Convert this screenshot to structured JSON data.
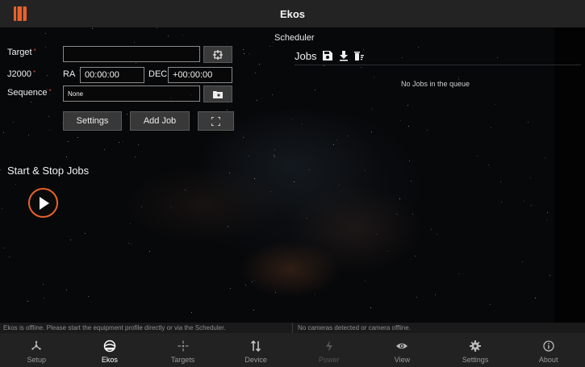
{
  "header": {
    "title": "Ekos",
    "app_icon": "notebook-icon"
  },
  "form": {
    "target_label": "Target",
    "target_value": "",
    "j2000_label": "J2000",
    "ra_label": "RA",
    "ra_value": "00:00:00",
    "dec_label": "DEC",
    "dec_value": "+00:00:00",
    "sequence_label": "Sequence",
    "sequence_value": "None",
    "required_marker": "*",
    "buttons": {
      "settings": "Settings",
      "add_job": "Add Job"
    }
  },
  "start_stop": {
    "title": "Start & Stop Jobs"
  },
  "scheduler": {
    "title": "Scheduler",
    "jobs_label": "Jobs",
    "empty_message": "No Jobs in the queue"
  },
  "status": {
    "left": "Ekos is offline. Please start the equipment profile directly or via the Scheduler.",
    "right": "No cameras detected or camera offline."
  },
  "nav": {
    "items": [
      {
        "label": "Setup",
        "icon": "setup-icon"
      },
      {
        "label": "Ekos",
        "icon": "ekos-icon"
      },
      {
        "label": "Targets",
        "icon": "targets-icon"
      },
      {
        "label": "Device",
        "icon": "device-icon"
      },
      {
        "label": "Power",
        "icon": "power-icon"
      },
      {
        "label": "View",
        "icon": "view-icon"
      },
      {
        "label": "Settings",
        "icon": "settings-icon"
      },
      {
        "label": "About",
        "icon": "about-icon"
      }
    ],
    "active": "Ekos"
  },
  "colors": {
    "accent": "#e8622a",
    "required": "#e0463e",
    "topbar": "#232323",
    "nav": "#222222"
  }
}
